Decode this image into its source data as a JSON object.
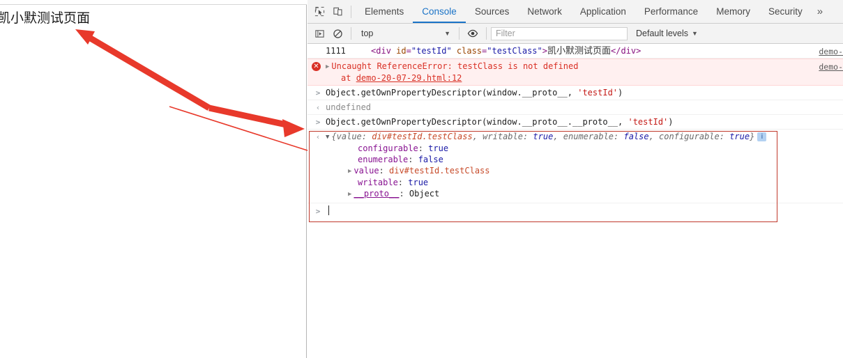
{
  "page": {
    "heading": "凯小默测试页面"
  },
  "devtools": {
    "toolbar": {
      "inspect_icon": "inspect-cursor-icon",
      "device_icon": "device-toolbar-icon",
      "tabs": [
        {
          "label": "Elements",
          "active": false
        },
        {
          "label": "Console",
          "active": true
        },
        {
          "label": "Sources",
          "active": false
        },
        {
          "label": "Network",
          "active": false
        },
        {
          "label": "Application",
          "active": false
        },
        {
          "label": "Performance",
          "active": false
        },
        {
          "label": "Memory",
          "active": false
        },
        {
          "label": "Security",
          "active": false
        }
      ],
      "more_tabs": "»"
    },
    "filterbar": {
      "execute_icon": "execution-context-icon",
      "clear_icon": "clear-console-icon",
      "context_value": "top",
      "context_caret": "▼",
      "eye_icon": "live-expression-eye-icon",
      "filter_placeholder": "Filter",
      "levels_label": "Default levels",
      "levels_caret": "▼"
    },
    "console": {
      "rows": [
        {
          "type": "log",
          "gutter": "",
          "number": "1111",
          "html_open_lt": "<",
          "html_tag": "div",
          "attr1_name": " id",
          "attr1_eq": "=",
          "attr1_value": "\"testId\"",
          "attr2_name": " class",
          "attr2_eq": "=",
          "attr2_value": "\"testClass\"",
          "html_open_gt": ">",
          "inner_text": "凯小默测试页面",
          "html_close": "</div>",
          "source": "demo-"
        },
        {
          "type": "error",
          "icon": "error-circle-icon",
          "triangle": "▶",
          "message": "Uncaught ReferenceError: testClass is not defined",
          "stack_at": "at ",
          "stack_link": "demo-20-07-29.html:12",
          "source": "demo-"
        },
        {
          "type": "input",
          "gutter": ">",
          "command": "Object.getOwnPropertyDescriptor(window.__proto__, ",
          "command_str": "'testId'",
          "command_end": ")"
        },
        {
          "type": "output",
          "gutter": "‹",
          "value": "undefined"
        },
        {
          "type": "input",
          "gutter": ">",
          "command": "Object.getOwnPropertyDescriptor(window.__proto__.__proto__, ",
          "command_str": "'testId'",
          "command_end": ")"
        },
        {
          "type": "object",
          "gutter": "‹",
          "triangle": "▼",
          "summary_open": "{value: ",
          "summary_dom": "div#testId.testClass",
          "summary_mid1": ", writable: ",
          "summary_writable": "true",
          "summary_mid2": ", enumerable: ",
          "summary_enumerable": "false",
          "summary_mid3": ", configurable: ",
          "summary_configurable": "true",
          "summary_close": "}",
          "info_badge": "i",
          "children": [
            {
              "triangle": "",
              "key": "configurable",
              "sep": ": ",
              "value": "true",
              "kind": "bool"
            },
            {
              "triangle": "",
              "key": "enumerable",
              "sep": ": ",
              "value": "false",
              "kind": "bool"
            },
            {
              "triangle": "▶",
              "key": "value",
              "sep": ": ",
              "value": "div#testId.testClass",
              "kind": "dom"
            },
            {
              "triangle": "",
              "key": "writable",
              "sep": ": ",
              "value": "true",
              "kind": "bool"
            },
            {
              "triangle": "▶",
              "key": "__proto__",
              "sep": ": ",
              "value": "Object",
              "kind": "plain"
            }
          ]
        }
      ],
      "prompt": {
        "arrow": ">",
        "value": ""
      }
    }
  },
  "annotations": {
    "highlight_box_color": "#c0392b",
    "arrow_color": "#e8392b",
    "arrow_to_page_title": "arrow-pointing-to-page-heading",
    "arrow_to_console_box": "arrow-pointing-to-console-output",
    "thin_line": "thin-red-line"
  }
}
